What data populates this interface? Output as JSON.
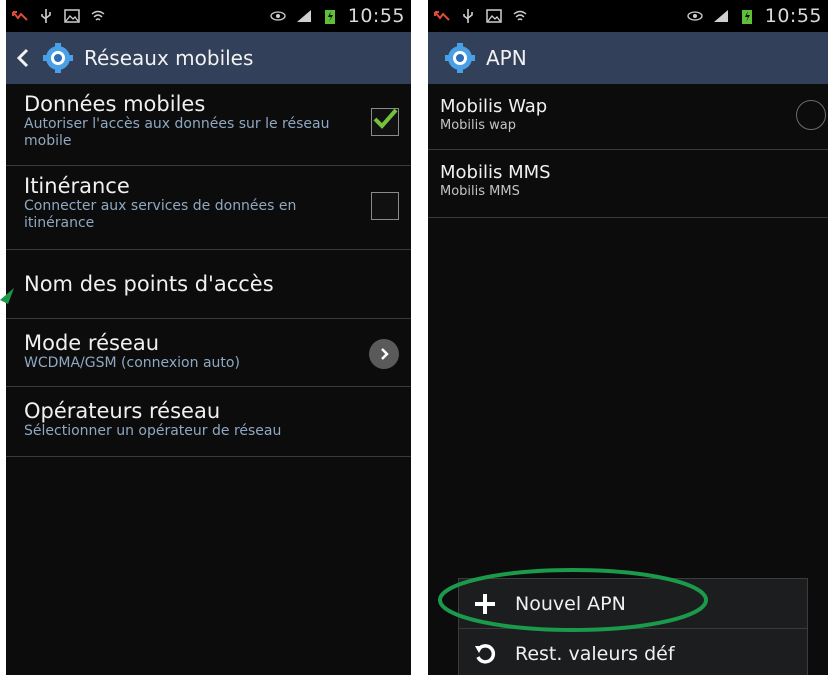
{
  "left": {
    "status_time": "10:55",
    "title": "Réseaux mobiles",
    "items": [
      {
        "title": "Données mobiles",
        "subtitle": "Autoriser l'accès aux données sur le réseau mobile"
      },
      {
        "title": "Itinérance",
        "subtitle": "Connecter aux services de données en itinérance"
      },
      {
        "title": "Nom des points d'accès",
        "subtitle": ""
      },
      {
        "title": "Mode réseau",
        "subtitle": "WCDMA/GSM (connexion auto)"
      },
      {
        "title": "Opérateurs réseau",
        "subtitle": "Sélectionner un opérateur de réseau"
      }
    ]
  },
  "right": {
    "status_time": "10:55",
    "title": "APN",
    "items": [
      {
        "title": "Mobilis Wap",
        "subtitle": "Mobilis wap"
      },
      {
        "title": "Mobilis MMS",
        "subtitle": "Mobilis MMS"
      }
    ],
    "menu": [
      {
        "label": "Nouvel APN",
        "icon": "plus-icon"
      },
      {
        "label": "Rest. valeurs déf",
        "icon": "reset-icon"
      }
    ]
  },
  "colors": {
    "actionbar": "#32405a",
    "background": "#0c0c0c",
    "subtitle": "#8fa8c2",
    "check": "#76c13c",
    "annotation": "#1a9a4a"
  }
}
